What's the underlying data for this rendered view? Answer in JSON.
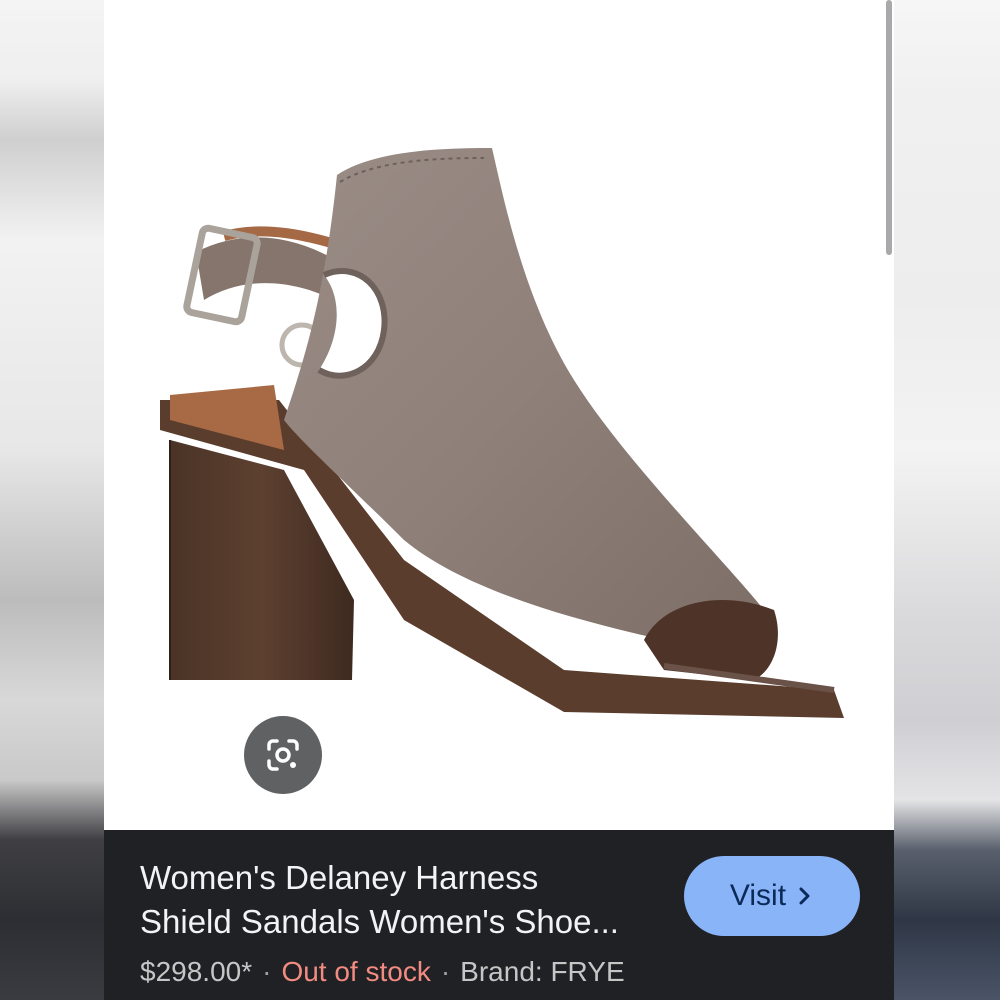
{
  "product": {
    "title_line1": "Women's Delaney Harness",
    "title_line2": "Shield Sandals Women's Shoe...",
    "price": "$298.00*",
    "availability": "Out of stock",
    "brand": "Brand: FRYE",
    "separator": "·"
  },
  "actions": {
    "visit_label": "Visit",
    "visit_icon": "chevron-right-icon",
    "lens_icon": "google-lens-icon"
  },
  "colors": {
    "info_bar": "#202124",
    "visit_button": "#8ab4f8",
    "out_of_stock": "#f28b82"
  }
}
